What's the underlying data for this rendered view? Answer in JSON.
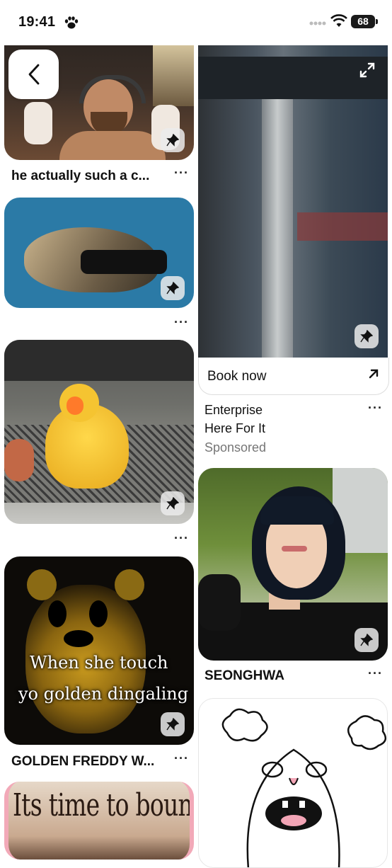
{
  "status_bar": {
    "time": "19:41",
    "battery": "68"
  },
  "nav": {
    "back_icon": "chevron-left-icon"
  },
  "feed": {
    "left": [
      {
        "caption": "he actually such a c...",
        "more": "···"
      },
      {
        "caption": "",
        "more": "···"
      },
      {
        "caption": "",
        "more": "···"
      },
      {
        "caption": "GOLDEN FREDDY W...",
        "more": "···",
        "overlay_line1": "When she touch",
        "overlay_line2": "yo golden dingaling"
      },
      {
        "overlay": "Its time to bounce"
      }
    ],
    "right": [
      {
        "cta": "Book now",
        "title_line1": "Enterprise",
        "title_line2": "Here For It",
        "sponsored": "Sponsored",
        "more": "···"
      },
      {
        "caption": "SEONGHWA",
        "more": "···"
      }
    ]
  },
  "colors": {
    "accent": "#111111",
    "sponsored": "#767676"
  }
}
